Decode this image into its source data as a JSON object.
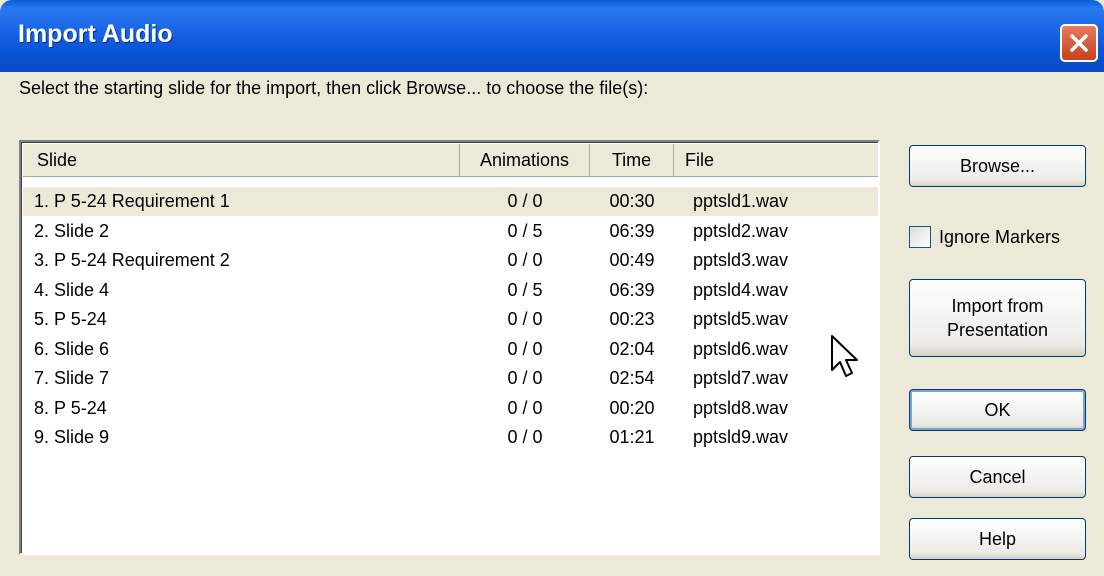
{
  "window": {
    "title": "Import Audio"
  },
  "instruction": "Select the starting slide for the import, then click Browse... to choose the file(s):",
  "table": {
    "columns": [
      "Slide",
      "Animations",
      "Time",
      "File"
    ],
    "selected_index": 0,
    "rows": [
      {
        "slide": "1. P 5-24 Requirement 1",
        "animations": "0 / 0",
        "time": "00:30",
        "file": "pptsld1.wav"
      },
      {
        "slide": "2. Slide 2",
        "animations": "0 / 5",
        "time": "06:39",
        "file": "pptsld2.wav"
      },
      {
        "slide": "3. P 5-24 Requirement 2",
        "animations": "0 / 0",
        "time": "00:49",
        "file": "pptsld3.wav"
      },
      {
        "slide": "4. Slide 4",
        "animations": "0 / 5",
        "time": "06:39",
        "file": "pptsld4.wav"
      },
      {
        "slide": "5. P 5-24",
        "animations": "0 / 0",
        "time": "00:23",
        "file": "pptsld5.wav"
      },
      {
        "slide": "6. Slide 6",
        "animations": "0 / 0",
        "time": "02:04",
        "file": "pptsld6.wav"
      },
      {
        "slide": "7. Slide 7",
        "animations": "0 / 0",
        "time": "02:54",
        "file": "pptsld7.wav"
      },
      {
        "slide": "8. P 5-24",
        "animations": "0 / 0",
        "time": "00:20",
        "file": "pptsld8.wav"
      },
      {
        "slide": "9. Slide 9",
        "animations": "0 / 0",
        "time": "01:21",
        "file": "pptsld9.wav"
      }
    ]
  },
  "buttons": {
    "browse": "Browse...",
    "import_line1": "Import from",
    "import_line2": "Presentation",
    "ok": "OK",
    "cancel": "Cancel",
    "help": "Help"
  },
  "ignore_markers": {
    "label": "Ignore Markers",
    "checked": false
  },
  "colors": {
    "titlebar": "#0A55D8",
    "face": "#ECE9D8",
    "close": "#C6411E",
    "button_border": "#003C74"
  },
  "icons": {
    "close": "close-icon",
    "pointer": "mouse-pointer-icon"
  }
}
